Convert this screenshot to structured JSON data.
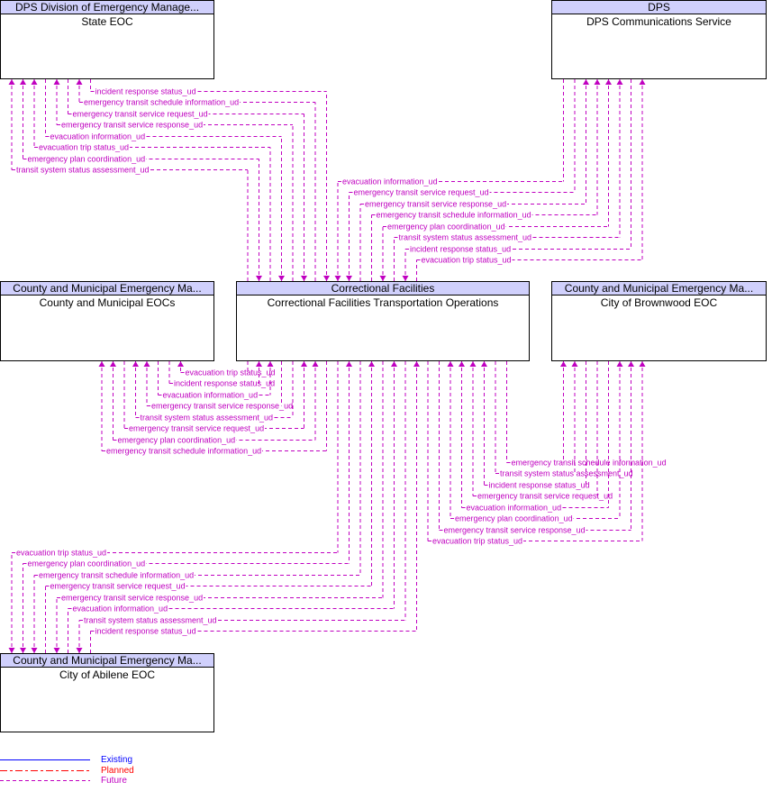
{
  "colors": {
    "future": "#c000c0",
    "planned": "#ff0000",
    "existing": "#0000ff",
    "header_bg": "#d0d0fc"
  },
  "center": {
    "owner": "Correctional Facilities",
    "name": "Correctional Facilities Transportation Operations"
  },
  "elements": {
    "state_eoc": {
      "owner": "DPS Division of Emergency Manage...",
      "name": "State EOC"
    },
    "dps_comm": {
      "owner": "DPS",
      "name": "DPS Communications Service"
    },
    "county_eocs": {
      "owner": "County and Municipal Emergency Ma...",
      "name": "County and Municipal EOCs"
    },
    "brownwood_eoc": {
      "owner": "County and Municipal Emergency Ma...",
      "name": "City of Brownwood EOC"
    },
    "abilene_eoc": {
      "owner": "County and Municipal Emergency Ma...",
      "name": "City of Abilene EOC"
    }
  },
  "flow_groups": [
    {
      "peer": "state_eoc",
      "status": "future",
      "flows": [
        {
          "label": "incident response status_ud",
          "direction": "to_center"
        },
        {
          "label": "emergency transit schedule information_ud",
          "direction": "from_center"
        },
        {
          "label": "emergency transit service request_ud",
          "direction": "to_center"
        },
        {
          "label": "emergency transit service response_ud",
          "direction": "from_center"
        },
        {
          "label": "evacuation information_ud",
          "direction": "to_center"
        },
        {
          "label": "evacuation trip status_ud",
          "direction": "from_center"
        },
        {
          "label": "emergency plan coordination_ud",
          "direction": "both"
        },
        {
          "label": "transit system status assessment_ud",
          "direction": "from_center"
        }
      ]
    },
    {
      "peer": "dps_comm",
      "status": "future",
      "flows": [
        {
          "label": "evacuation information_ud",
          "direction": "to_center"
        },
        {
          "label": "emergency transit service request_ud",
          "direction": "to_center"
        },
        {
          "label": "emergency transit service response_ud",
          "direction": "from_center"
        },
        {
          "label": "emergency transit schedule information_ud",
          "direction": "from_center"
        },
        {
          "label": "emergency plan coordination_ud",
          "direction": "both"
        },
        {
          "label": "transit system status assessment_ud",
          "direction": "from_center"
        },
        {
          "label": "incident response status_ud",
          "direction": "to_center"
        },
        {
          "label": "evacuation trip status_ud",
          "direction": "from_center"
        }
      ]
    },
    {
      "peer": "county_eocs",
      "status": "future",
      "flows": [
        {
          "label": "evacuation trip status_ud",
          "direction": "from_center"
        },
        {
          "label": "incident response status_ud",
          "direction": "to_center"
        },
        {
          "label": "evacuation information_ud",
          "direction": "to_center"
        },
        {
          "label": "emergency transit service response_ud",
          "direction": "from_center"
        },
        {
          "label": "transit system status assessment_ud",
          "direction": "from_center"
        },
        {
          "label": "emergency transit service request_ud",
          "direction": "to_center"
        },
        {
          "label": "emergency plan coordination_ud",
          "direction": "both"
        },
        {
          "label": "emergency transit schedule information_ud",
          "direction": "from_center"
        }
      ]
    },
    {
      "peer": "brownwood_eoc",
      "status": "future",
      "flows": [
        {
          "label": "emergency transit schedule information_ud",
          "direction": "from_center"
        },
        {
          "label": "transit system status assessment_ud",
          "direction": "from_center"
        },
        {
          "label": "incident response status_ud",
          "direction": "to_center"
        },
        {
          "label": "emergency transit service request_ud",
          "direction": "to_center"
        },
        {
          "label": "evacuation information_ud",
          "direction": "to_center"
        },
        {
          "label": "emergency plan coordination_ud",
          "direction": "both"
        },
        {
          "label": "emergency transit service response_ud",
          "direction": "from_center"
        },
        {
          "label": "evacuation trip status_ud",
          "direction": "from_center"
        }
      ]
    },
    {
      "peer": "abilene_eoc",
      "status": "future",
      "flows": [
        {
          "label": "evacuation trip status_ud",
          "direction": "from_center"
        },
        {
          "label": "emergency plan coordination_ud",
          "direction": "both"
        },
        {
          "label": "emergency transit schedule information_ud",
          "direction": "from_center"
        },
        {
          "label": "emergency transit service request_ud",
          "direction": "to_center"
        },
        {
          "label": "emergency transit service response_ud",
          "direction": "from_center"
        },
        {
          "label": "evacuation information_ud",
          "direction": "to_center"
        },
        {
          "label": "transit system status assessment_ud",
          "direction": "from_center"
        },
        {
          "label": "incident response status_ud",
          "direction": "to_center"
        }
      ]
    }
  ],
  "legend": {
    "items": [
      {
        "label": "Existing",
        "color": "#0000ff",
        "style": "solid"
      },
      {
        "label": "Planned",
        "color": "#ff0000",
        "style": "dash-dot"
      },
      {
        "label": "Future",
        "color": "#c000c0",
        "style": "dashed"
      }
    ]
  }
}
